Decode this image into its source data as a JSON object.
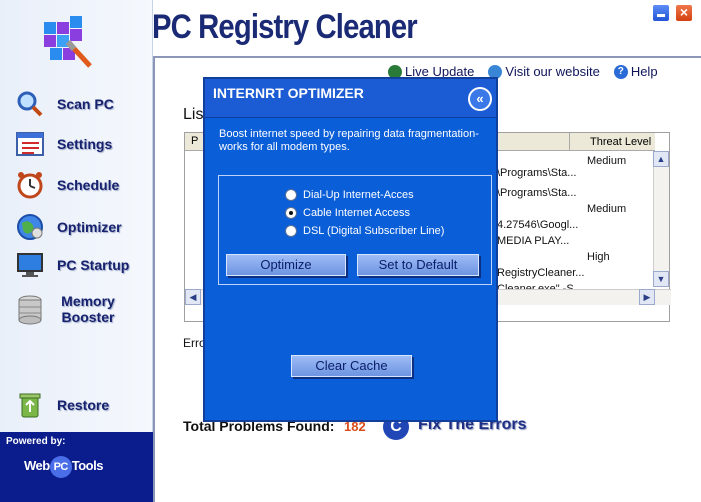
{
  "app": {
    "title": "PC Registry Cleaner"
  },
  "window": {
    "minimize_icon": "minimize-icon",
    "close_glyph": "×"
  },
  "sidebar": {
    "items": [
      {
        "label": "Scan PC",
        "icon": "magnifier-icon"
      },
      {
        "label": "Settings",
        "icon": "checklist-icon"
      },
      {
        "label": "Schedule",
        "icon": "alarm-clock-icon"
      },
      {
        "label": "Optimizer",
        "icon": "globe-icon"
      },
      {
        "label": "PC Startup",
        "icon": "monitor-icon"
      },
      {
        "label": "Memory Booster",
        "icon": "database-icon"
      },
      {
        "label": "Restore",
        "icon": "recycle-icon"
      }
    ],
    "powered_by": "Powered by:",
    "brand_left": "Web",
    "brand_mid": "PC",
    "brand_right": "Tools"
  },
  "toplinks": {
    "live_update": "Live Update",
    "visit_website": "Visit our website",
    "help": "Help"
  },
  "main": {
    "list_label": "Lis",
    "columns": {
      "pr": "Pr",
      "threat": "Threat Level"
    },
    "rows": [
      {
        "path": "\\Programs\\Sta...",
        "threat": "Medium"
      },
      {
        "path": "\\Programs\\Sta...",
        "threat": ""
      },
      {
        "path": "4.27546\\Googl...",
        "threat": "Medium"
      },
      {
        "path": "MEDIA PLAY...",
        "threat": ""
      },
      {
        "path": "RegistryCleaner...",
        "threat": "High"
      },
      {
        "path": "Cleaner.exe\" -S...",
        "threat": ""
      }
    ],
    "errors_label": "Erro",
    "total_label": "Total Problems Found:",
    "total_count": "182",
    "fix_label": "Fix The Errors",
    "fix_icon_glyph": "C"
  },
  "dialog": {
    "title": "INTERNRT OPTIMIZER",
    "close_glyph": "«",
    "description": "Boost internet speed by repairing data fragmentation-works for all modem types.",
    "options": [
      {
        "label": "Dial-Up Internet-Acces",
        "selected": false
      },
      {
        "label": "Cable Internet Access",
        "selected": true
      },
      {
        "label": "DSL (Digital Subscriber Line)",
        "selected": false
      }
    ],
    "optimize_label": "Optimize",
    "default_label": "Set to Default",
    "clear_cache_label": "Clear Cache"
  },
  "colors": {
    "dialog_bg": "#0a5ed8",
    "title_color": "#1a2a74",
    "sidebar_bg": "#e9eff9",
    "count_color": "#d94e1c"
  }
}
